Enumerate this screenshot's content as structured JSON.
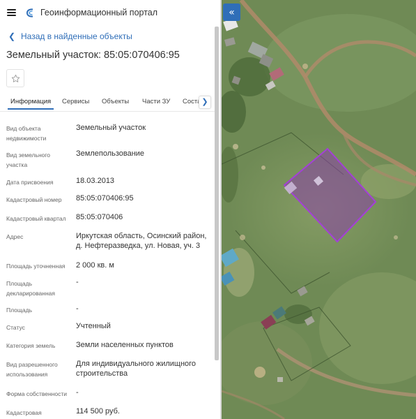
{
  "header": {
    "app_title": "Геоинформационный портал"
  },
  "navigation": {
    "back_label": "Назад в найденные объекты"
  },
  "object": {
    "title": "Земельный участок: 85:05:070406:95"
  },
  "tabs": [
    {
      "label": "Информация",
      "active": true
    },
    {
      "label": "Сервисы",
      "active": false
    },
    {
      "label": "Объекты",
      "active": false
    },
    {
      "label": "Части ЗУ",
      "active": false
    },
    {
      "label": "Соста",
      "active": false
    }
  ],
  "attributes": [
    {
      "label": "Вид объекта недвижимости",
      "value": "Земельный участок"
    },
    {
      "label": "Вид земельного участка",
      "value": "Землепользование"
    },
    {
      "label": "Дата присвоения",
      "value": "18.03.2013"
    },
    {
      "label": "Кадастровый номер",
      "value": "85:05:070406:95"
    },
    {
      "label": "Кадастровый квартал",
      "value": "85:05:070406"
    },
    {
      "label": "Адрес",
      "value": "Иркутская область, Осинский район, д. Нефтеразведка, ул. Новая, уч. 3"
    },
    {
      "label": "Площадь уточненная",
      "value": "2 000 кв. м"
    },
    {
      "label": "Площадь декларированная",
      "value": "-"
    },
    {
      "label": "Площадь",
      "value": "-"
    },
    {
      "label": "Статус",
      "value": "Учтенный"
    },
    {
      "label": "Категория земель",
      "value": "Земли населенных пунктов"
    },
    {
      "label": "Вид разрешенного использования",
      "value": "Для индивидуального жилищного строительства"
    },
    {
      "label": "Форма собственности",
      "value": "-"
    },
    {
      "label": "Кадастровая",
      "value": "114 500 руб."
    }
  ],
  "icons": {
    "menu": "hamburger-icon",
    "logo": "portal-logo-icon",
    "back": "chevron-left-icon",
    "favorite": "star-outline-icon",
    "tabs_next": "chevron-right-icon",
    "collapse": "double-chevron-left-icon"
  },
  "colors": {
    "accent": "#2f6eb8",
    "parcel_fill": "#8b3fa8",
    "parcel_stroke": "#a43fd8"
  }
}
